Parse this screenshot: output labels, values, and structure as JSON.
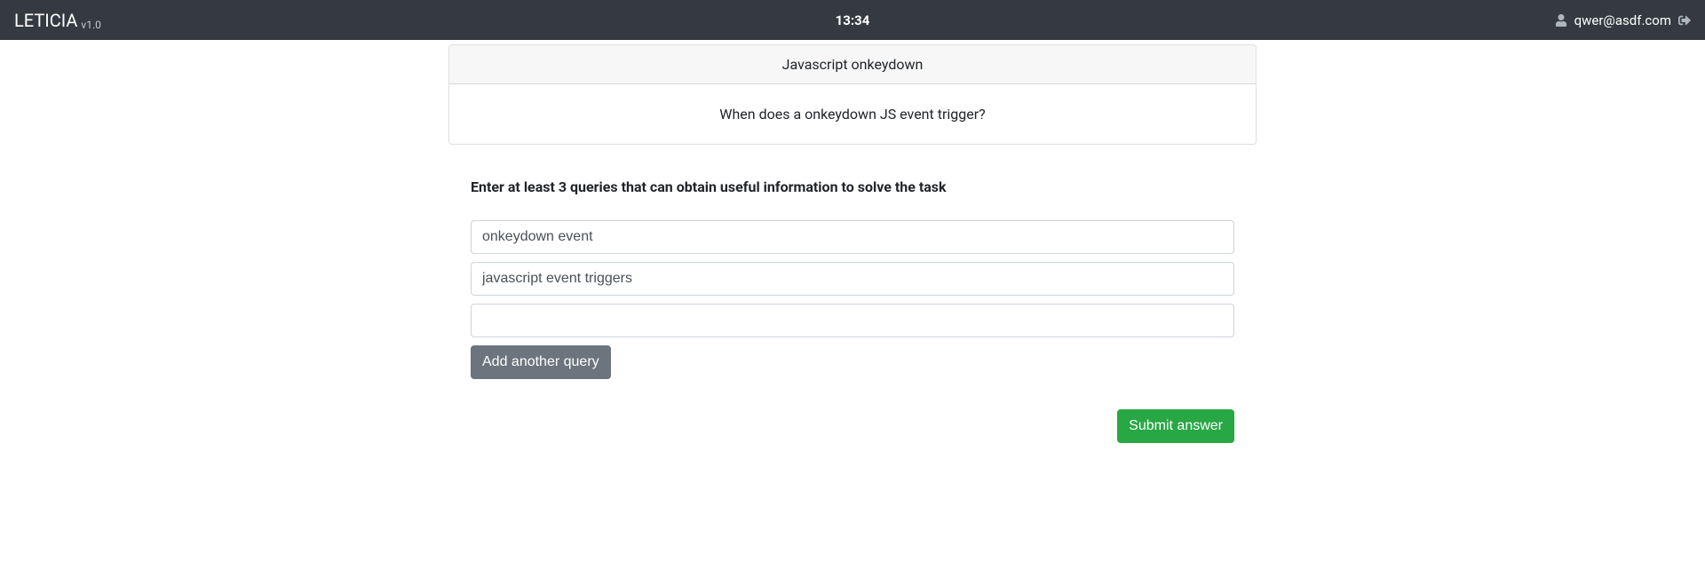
{
  "navbar": {
    "brand": "LETICIA",
    "version": "v1.0",
    "time": "13:34",
    "user_email": "qwer@asdf.com"
  },
  "card": {
    "title": "Javascript onkeydown",
    "question": "When does a onkeydown JS event trigger?"
  },
  "form": {
    "instruction": "Enter at least 3 queries that can obtain useful information to solve the task",
    "queries": [
      "onkeydown event",
      "javascript event triggers",
      ""
    ],
    "add_button": "Add another query",
    "submit_button": "Submit answer"
  }
}
